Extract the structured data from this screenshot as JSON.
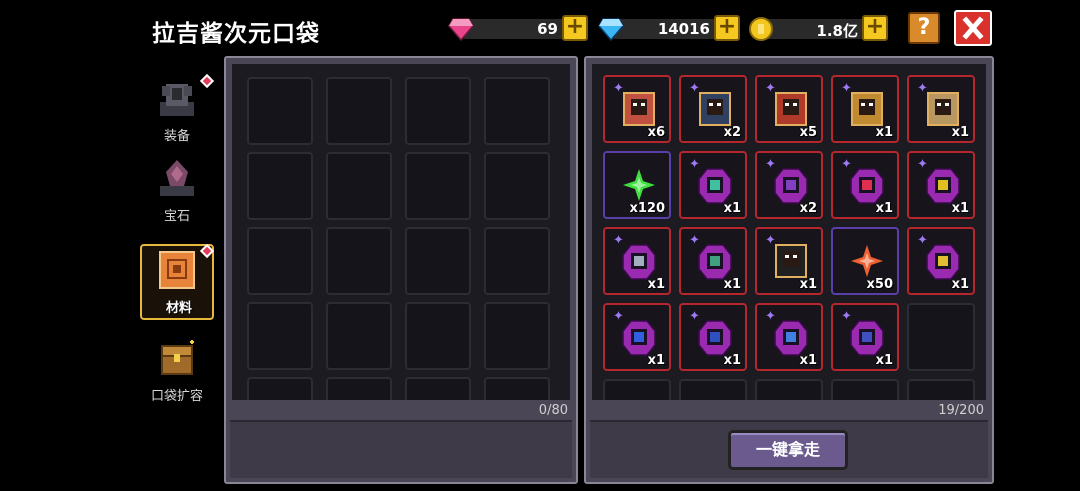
{
  "title": "拉吉酱次元口袋",
  "currencies": {
    "pink_gem": {
      "value": "69",
      "icon": "pink-gem-icon",
      "color": "#e8458a"
    },
    "blue_gem": {
      "value": "14016",
      "icon": "blue-gem-icon",
      "color": "#3ab6f2"
    },
    "gold": {
      "value": "1.8亿",
      "icon": "gold-coin-icon",
      "color": "#f2c81e"
    }
  },
  "header": {
    "help_label": "?"
  },
  "tabs": [
    {
      "label": "装备",
      "icon": "armor-icon",
      "has_dot": true
    },
    {
      "label": "宝石",
      "icon": "gem-altar-icon",
      "has_dot": false
    },
    {
      "label": "材料",
      "icon": "material-book-icon",
      "has_dot": true,
      "active": true
    },
    {
      "label": "口袋扩容",
      "icon": "chest-icon",
      "has_dot": false
    }
  ],
  "left_panel": {
    "count": "0/80"
  },
  "right_panel": {
    "count": "19/200",
    "items": [
      {
        "qty": "x6",
        "icon": "hero-portrait-icon",
        "color": "#c05040"
      },
      {
        "qty": "x2",
        "icon": "dark-hero-portrait-icon",
        "color": "#304060"
      },
      {
        "qty": "x5",
        "icon": "red-hero-portrait-icon",
        "color": "#b03a2a"
      },
      {
        "qty": "x1",
        "icon": "gold-hero-portrait-icon",
        "color": "#c08a30"
      },
      {
        "qty": "x1",
        "icon": "elder-portrait-icon",
        "color": "#b89860"
      },
      {
        "qty": "x120",
        "icon": "green-star-icon",
        "color": "#40e040"
      },
      {
        "qty": "x1",
        "icon": "teal-rune-crystal-icon",
        "color": "#40c0a0"
      },
      {
        "qty": "x2",
        "icon": "swirl-rune-crystal-icon",
        "color": "#8040c0"
      },
      {
        "qty": "x1",
        "icon": "red-rune-crystal-icon",
        "color": "#e03050"
      },
      {
        "qty": "x1",
        "icon": "crown-rune-crystal-icon",
        "color": "#e0c020"
      },
      {
        "qty": "x1",
        "icon": "dog-rune-crystal-icon",
        "color": "#a0b0c0"
      },
      {
        "qty": "x1",
        "icon": "target-rune-crystal-icon",
        "color": "#40a080"
      },
      {
        "qty": "x1",
        "icon": "shadow-portrait-icon",
        "color": "#202020"
      },
      {
        "qty": "x50",
        "icon": "orange-star-icon",
        "color": "#f06030"
      },
      {
        "qty": "x1",
        "icon": "glyph-rune-crystal-icon",
        "color": "#e0c030"
      },
      {
        "qty": "x1",
        "icon": "blue-bolt-crystal-icon",
        "color": "#3060e0"
      },
      {
        "qty": "x1",
        "icon": "blue-sword-crystal-icon",
        "color": "#3050c0"
      },
      {
        "qty": "x1",
        "icon": "moon-crystal-icon",
        "color": "#4080e0"
      },
      {
        "qty": "x1",
        "icon": "blue-cross-crystal-icon",
        "color": "#4050c0"
      }
    ]
  },
  "take_all_label": "一键拿走"
}
